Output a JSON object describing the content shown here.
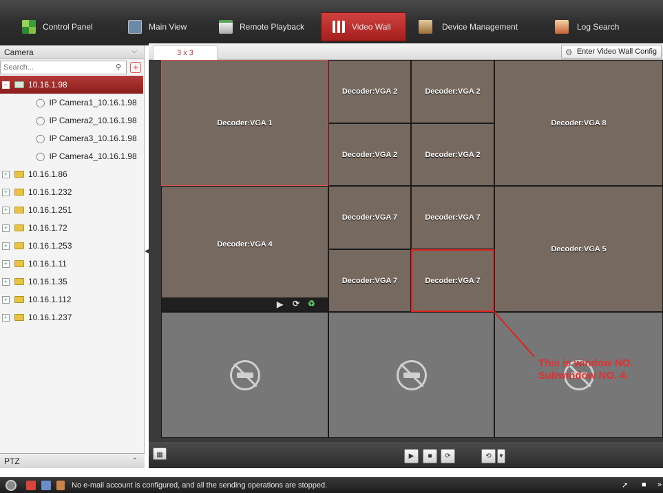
{
  "nav": {
    "tabs": [
      {
        "label": "Control Panel",
        "icon": "control-panel-icon"
      },
      {
        "label": "Main View",
        "icon": "main-view-icon"
      },
      {
        "label": "Remote Playback",
        "icon": "remote-playback-icon"
      },
      {
        "label": "Video Wall",
        "icon": "video-wall-icon",
        "active": true
      },
      {
        "label": "Device Management",
        "icon": "device-management-icon"
      },
      {
        "label": "Log Search",
        "icon": "log-search-icon"
      }
    ]
  },
  "left": {
    "camera_header": "Camera",
    "search_placeholder": "Search...",
    "tree": [
      {
        "label": "10.16.1.98",
        "expanded": true,
        "selected": true,
        "children": [
          "IP Camera1_10.16.1.98",
          "IP Camera2_10.16.1.98",
          "IP Camera3_10.16.1.98",
          "IP Camera4_10.16.1.98"
        ]
      },
      {
        "label": "10.16.1.86"
      },
      {
        "label": "10.16.1.232"
      },
      {
        "label": "10.16.1.251"
      },
      {
        "label": "10.16.1.72"
      },
      {
        "label": "10.16.1.253"
      },
      {
        "label": "10.16.1.11"
      },
      {
        "label": "10.16.1.35"
      },
      {
        "label": "10.16.1.112"
      },
      {
        "label": "10.16.1.237"
      }
    ],
    "ptz_header": "PTZ"
  },
  "main": {
    "wall_tab": "3 x 3",
    "enter_config_button": "Enter Video Wall Config",
    "windows": {
      "w1": "Decoder:VGA 1",
      "w2a": "Decoder:VGA 2",
      "w2b": "Decoder:VGA 2",
      "w2c": "Decoder:VGA 2",
      "w2d": "Decoder:VGA 2",
      "w8": "Decoder:VGA 8",
      "w4": "Decoder:VGA 4",
      "w7a": "Decoder:VGA 7",
      "w7b": "Decoder:VGA 7",
      "w7c": "Decoder:VGA 7",
      "w7d": "Decoder:VGA 7",
      "w5": "Decoder:VGA 5"
    },
    "annotation_line1": "This is window NO.",
    "annotation_line2": "Subwindow NO. 4."
  },
  "status": {
    "message": "No e-mail account is configured, and all the sending operations are stopped."
  },
  "colors": {
    "active_tab": "#b83230",
    "decoder_window": "#76695f",
    "annotation": "#e03030"
  }
}
